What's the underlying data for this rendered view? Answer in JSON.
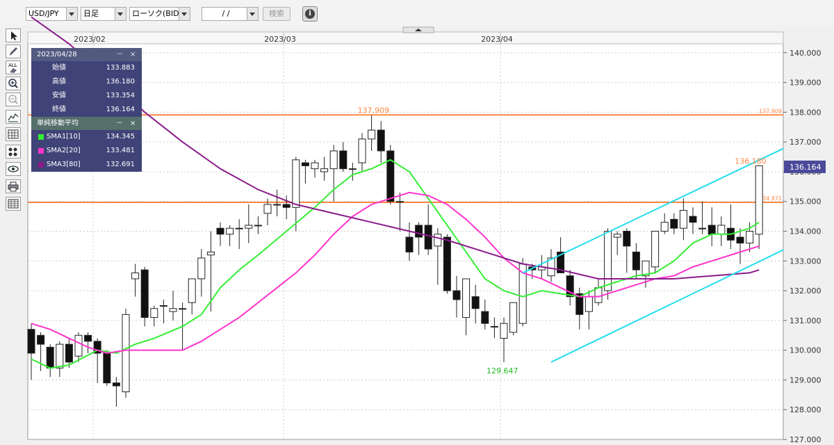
{
  "toolbar": {
    "pair": "USD/JPY",
    "period": "日足",
    "chart_type": "ローソク(BID)",
    "date": "/ /",
    "search_label": "検索"
  },
  "sidebar": {
    "tools": [
      "cursor-icon",
      "pen-icon",
      "all-erase-icon",
      "zoom-in-icon",
      "zoom-out-icon",
      "line-chart-icon",
      "grid-icon",
      "indicator-icon",
      "eye-icon",
      "print-icon",
      "table-icon"
    ]
  },
  "legend": {
    "date": "2023/04/28",
    "minimize": "－",
    "close": "×",
    "rows": [
      {
        "label": "始値",
        "value": "133.883"
      },
      {
        "label": "高値",
        "value": "136.180"
      },
      {
        "label": "安値",
        "value": "133.354"
      },
      {
        "label": "終値",
        "value": "136.164"
      }
    ],
    "sma_title": "単純移動平均",
    "sma": [
      {
        "label": "SMA1[10]",
        "value": "134.345",
        "color": "#33ee33"
      },
      {
        "label": "SMA2[20]",
        "value": "133.481",
        "color": "#ff33cc"
      },
      {
        "label": "SMA3[80]",
        "value": "132.691",
        "color": "#8a1a8a"
      }
    ]
  },
  "chart_data": {
    "type": "candlestick",
    "instrument": "USD/JPY",
    "x_labels": [
      "2023/02",
      "2023/03",
      "2023/04"
    ],
    "ylim": [
      127,
      140.3
    ],
    "yticks": [
      "127.000",
      "128.000",
      "129.000",
      "130.000",
      "131.000",
      "132.000",
      "133.000",
      "134.000",
      "135.000",
      "136.000",
      "137.000",
      "138.000",
      "139.000",
      "140.000"
    ],
    "current_price": "136.164",
    "annotations": [
      {
        "text": "137.909",
        "y": 137.909
      },
      {
        "text": "136.180",
        "y": 136.18
      },
      {
        "text": "129.647",
        "y": 129.647
      }
    ],
    "horizontal_lines": [
      {
        "label": "137.909",
        "y": 137.909,
        "color": "#ff8844"
      },
      {
        "label": "134.971",
        "y": 134.971,
        "color": "#ff8844"
      }
    ],
    "channel_color": "#22ddee",
    "candles": [
      [
        130.7,
        130.9,
        129.0,
        129.9
      ],
      [
        130.5,
        130.6,
        129.3,
        130.2
      ],
      [
        130.1,
        130.2,
        129.1,
        129.4
      ],
      [
        129.4,
        130.3,
        129.1,
        130.2
      ],
      [
        130.2,
        130.4,
        129.4,
        129.6
      ],
      [
        129.8,
        130.6,
        129.6,
        130.5
      ],
      [
        130.5,
        130.6,
        129.9,
        130.3
      ],
      [
        130.3,
        130.4,
        128.9,
        129.9
      ],
      [
        129.9,
        130.0,
        128.8,
        128.9
      ],
      [
        128.9,
        129.1,
        128.1,
        128.8
      ],
      [
        128.6,
        131.4,
        128.4,
        131.2
      ],
      [
        132.4,
        132.9,
        131.8,
        132.6
      ],
      [
        132.7,
        132.8,
        130.8,
        131.1
      ],
      [
        131.1,
        131.5,
        130.8,
        131.4
      ],
      [
        131.5,
        131.7,
        130.9,
        131.5
      ],
      [
        131.3,
        132.0,
        131.0,
        131.4
      ],
      [
        131.4,
        131.6,
        130.0,
        131.4
      ],
      [
        131.6,
        132.4,
        131.2,
        132.4
      ],
      [
        132.4,
        133.4,
        131.8,
        133.1
      ],
      [
        133.2,
        134.0,
        131.3,
        133.3
      ],
      [
        134.1,
        134.3,
        133.5,
        133.9
      ],
      [
        133.9,
        134.2,
        133.5,
        134.1
      ],
      [
        134.1,
        134.4,
        133.4,
        134.1
      ],
      [
        134.1,
        134.9,
        133.6,
        134.2
      ],
      [
        134.2,
        134.5,
        133.9,
        134.2
      ],
      [
        134.6,
        135.1,
        134.2,
        134.9
      ],
      [
        134.9,
        135.4,
        134.5,
        134.9
      ],
      [
        134.9,
        135.2,
        134.4,
        134.8
      ],
      [
        134.8,
        136.5,
        134.0,
        136.4
      ],
      [
        136.3,
        136.4,
        135.6,
        136.2
      ],
      [
        136.1,
        136.4,
        135.8,
        136.3
      ],
      [
        136.0,
        136.5,
        135.7,
        136.1
      ],
      [
        136.1,
        136.9,
        135.0,
        136.7
      ],
      [
        136.7,
        137.0,
        136.0,
        136.1
      ],
      [
        136.1,
        136.3,
        135.7,
        136.1
      ],
      [
        136.3,
        137.3,
        136.0,
        137.1
      ],
      [
        137.1,
        137.9,
        136.7,
        137.4
      ],
      [
        137.4,
        137.7,
        136.3,
        136.7
      ],
      [
        136.7,
        136.9,
        134.9,
        135.0
      ],
      [
        135.0,
        135.3,
        134.0,
        135.0
      ],
      [
        133.8,
        134.3,
        133.0,
        133.3
      ],
      [
        134.2,
        134.3,
        133.2,
        133.8
      ],
      [
        134.2,
        134.9,
        133.2,
        133.4
      ],
      [
        133.5,
        134.1,
        132.2,
        133.9
      ],
      [
        133.8,
        133.9,
        131.9,
        132.0
      ],
      [
        132.0,
        132.5,
        131.1,
        131.7
      ],
      [
        131.1,
        132.4,
        130.5,
        132.4
      ],
      [
        131.8,
        132.2,
        130.9,
        131.4
      ],
      [
        131.3,
        131.7,
        130.7,
        130.9
      ],
      [
        130.8,
        131.1,
        130.4,
        130.8
      ],
      [
        130.4,
        131.1,
        129.6,
        130.9
      ],
      [
        130.6,
        131.6,
        130.5,
        131.6
      ],
      [
        130.9,
        133.1,
        130.8,
        132.9
      ],
      [
        132.8,
        132.9,
        132.4,
        132.7
      ],
      [
        132.7,
        133.2,
        132.4,
        132.8
      ],
      [
        132.5,
        133.4,
        132.3,
        133.1
      ],
      [
        133.3,
        133.8,
        132.6,
        132.6
      ],
      [
        132.5,
        132.7,
        131.5,
        131.8
      ],
      [
        131.9,
        132.1,
        130.7,
        131.2
      ],
      [
        131.3,
        132.0,
        130.7,
        131.8
      ],
      [
        131.6,
        132.4,
        131.5,
        132.1
      ],
      [
        132.0,
        134.1,
        131.7,
        134.0
      ],
      [
        133.8,
        134.0,
        133.2,
        133.9
      ],
      [
        134.0,
        134.1,
        132.6,
        133.5
      ],
      [
        133.3,
        133.6,
        132.4,
        132.7
      ],
      [
        132.5,
        132.8,
        132.1,
        133.0
      ],
      [
        132.8,
        134.0,
        132.6,
        134.0
      ],
      [
        134.0,
        134.6,
        133.9,
        134.3
      ],
      [
        134.4,
        134.6,
        133.9,
        134.1
      ],
      [
        134.1,
        135.1,
        133.7,
        134.7
      ],
      [
        134.5,
        134.8,
        133.9,
        134.3
      ],
      [
        134.1,
        135.0,
        133.9,
        134.1
      ],
      [
        134.2,
        134.8,
        133.5,
        133.9
      ],
      [
        133.9,
        134.5,
        133.5,
        134.2
      ],
      [
        134.1,
        134.9,
        133.4,
        133.7
      ],
      [
        133.8,
        134.1,
        132.9,
        133.6
      ],
      [
        133.6,
        134.3,
        133.3,
        134.0
      ],
      [
        133.9,
        136.2,
        133.4,
        136.2
      ]
    ],
    "sma": [
      {
        "name": "SMA1[10]",
        "color": "#33ee33",
        "values": [
          [
            0,
            129.7
          ],
          [
            2,
            129.4
          ],
          [
            4,
            129.5
          ],
          [
            7,
            130.0
          ],
          [
            9,
            129.9
          ],
          [
            11,
            130.2
          ],
          [
            13,
            130.4
          ],
          [
            16,
            130.8
          ],
          [
            18,
            131.2
          ],
          [
            20,
            132.1
          ],
          [
            22,
            132.7
          ],
          [
            24,
            133.2
          ],
          [
            27,
            134.0
          ],
          [
            30,
            134.8
          ],
          [
            32,
            135.4
          ],
          [
            34,
            135.9
          ],
          [
            36,
            136.1
          ],
          [
            38,
            136.4
          ],
          [
            40,
            136.0
          ],
          [
            42,
            135.1
          ],
          [
            44,
            134.2
          ],
          [
            46,
            133.3
          ],
          [
            48,
            132.4
          ],
          [
            50,
            132.0
          ],
          [
            52,
            131.8
          ],
          [
            54,
            132.0
          ],
          [
            56,
            131.9
          ],
          [
            58,
            131.8
          ],
          [
            60,
            132.1
          ],
          [
            62,
            132.3
          ],
          [
            64,
            132.5
          ],
          [
            66,
            132.6
          ],
          [
            68,
            133.0
          ],
          [
            70,
            133.6
          ],
          [
            72,
            133.9
          ],
          [
            74,
            133.9
          ],
          [
            76,
            134.1
          ],
          [
            77,
            134.3
          ]
        ]
      },
      {
        "name": "SMA2[20]",
        "color": "#ff33cc",
        "values": [
          [
            0,
            130.9
          ],
          [
            2,
            130.7
          ],
          [
            4,
            130.4
          ],
          [
            6,
            130.1
          ],
          [
            8,
            129.9
          ],
          [
            10,
            130.0
          ],
          [
            12,
            130.0
          ],
          [
            14,
            130.0
          ],
          [
            16,
            130.0
          ],
          [
            18,
            130.3
          ],
          [
            20,
            130.7
          ],
          [
            22,
            131.1
          ],
          [
            24,
            131.6
          ],
          [
            26,
            132.1
          ],
          [
            28,
            132.6
          ],
          [
            30,
            133.2
          ],
          [
            32,
            133.9
          ],
          [
            34,
            134.5
          ],
          [
            36,
            134.9
          ],
          [
            38,
            135.1
          ],
          [
            40,
            135.3
          ],
          [
            42,
            135.2
          ],
          [
            44,
            134.9
          ],
          [
            46,
            134.4
          ],
          [
            48,
            133.8
          ],
          [
            50,
            133.1
          ],
          [
            52,
            132.6
          ],
          [
            54,
            132.4
          ],
          [
            56,
            132.1
          ],
          [
            58,
            131.8
          ],
          [
            60,
            131.8
          ],
          [
            62,
            132.0
          ],
          [
            64,
            132.2
          ],
          [
            66,
            132.4
          ],
          [
            68,
            132.5
          ],
          [
            70,
            132.8
          ],
          [
            72,
            133.0
          ],
          [
            74,
            133.2
          ],
          [
            76,
            133.4
          ],
          [
            77,
            133.5
          ]
        ]
      },
      {
        "name": "SMA3[80]",
        "color": "#8a1a8a",
        "values": [
          [
            0,
            141.2
          ],
          [
            4,
            140.3
          ],
          [
            8,
            139.2
          ],
          [
            12,
            138.0
          ],
          [
            16,
            137.0
          ],
          [
            20,
            136.1
          ],
          [
            24,
            135.4
          ],
          [
            28,
            134.9
          ],
          [
            32,
            134.6
          ],
          [
            36,
            134.3
          ],
          [
            40,
            134.0
          ],
          [
            44,
            133.7
          ],
          [
            48,
            133.3
          ],
          [
            52,
            132.9
          ],
          [
            56,
            132.7
          ],
          [
            60,
            132.4
          ],
          [
            64,
            132.4
          ],
          [
            68,
            132.4
          ],
          [
            72,
            132.5
          ],
          [
            76,
            132.6
          ],
          [
            77,
            132.7
          ]
        ]
      }
    ],
    "channel_lines": [
      {
        "from": [
          52,
          132.6
        ],
        "to": [
          83,
          137.3
        ]
      },
      {
        "from": [
          55,
          129.6
        ],
        "to": [
          83,
          133.9
        ]
      }
    ]
  }
}
